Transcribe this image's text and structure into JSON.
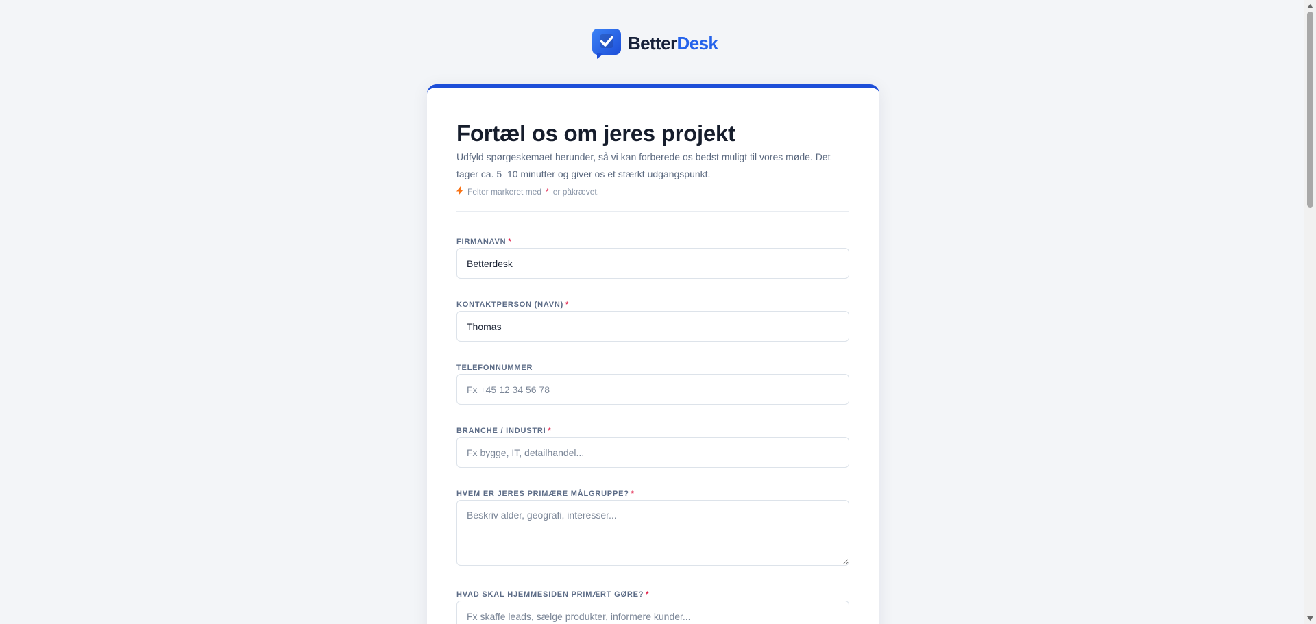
{
  "brand": {
    "name_part1": "Better",
    "name_part2": "Desk",
    "colors": {
      "accent": "#2563eb",
      "accent_dark": "#1d4ed8",
      "required": "#e11d48",
      "bolt": "#f97316"
    }
  },
  "form": {
    "title": "Fortæl os om jeres projekt",
    "intro": "Udfyld spørgeskemaet herunder, så vi kan forberede os bedst muligt til vores møde. Det tager ca. 5–10 minutter og giver os et stærkt udgangspunkt.",
    "required_note": {
      "prefix": "Felter markeret med",
      "star": "*",
      "suffix": "er påkrævet.",
      "icon": "bolt-icon"
    },
    "fields": [
      {
        "label": "FIRMANAVN",
        "required": true,
        "value": "Betterdesk",
        "placeholder": ""
      },
      {
        "label": "KONTAKTPERSON (NAVN)",
        "required": true,
        "value": "Thomas",
        "placeholder": ""
      },
      {
        "label": "TELEFONNUMMER",
        "required": false,
        "value": "",
        "placeholder": "Fx +45 12 34 56 78"
      },
      {
        "label": "BRANCHE / INDUSTRI",
        "required": true,
        "value": "",
        "placeholder": "Fx bygge, IT, detailhandel..."
      },
      {
        "label": "HVEM ER JERES PRIMÆRE MÅLGRUPPE?",
        "required": true,
        "value": "",
        "placeholder": "Beskriv alder, geografi, interesser..."
      },
      {
        "label": "HVAD SKAL HJEMMESIDEN PRIMÆRT GØRE?",
        "required": true,
        "value": "",
        "placeholder": "Fx skaffe leads, sælge produkter, informere kunder..."
      }
    ]
  },
  "scrollbar": {
    "position": 0.0
  }
}
